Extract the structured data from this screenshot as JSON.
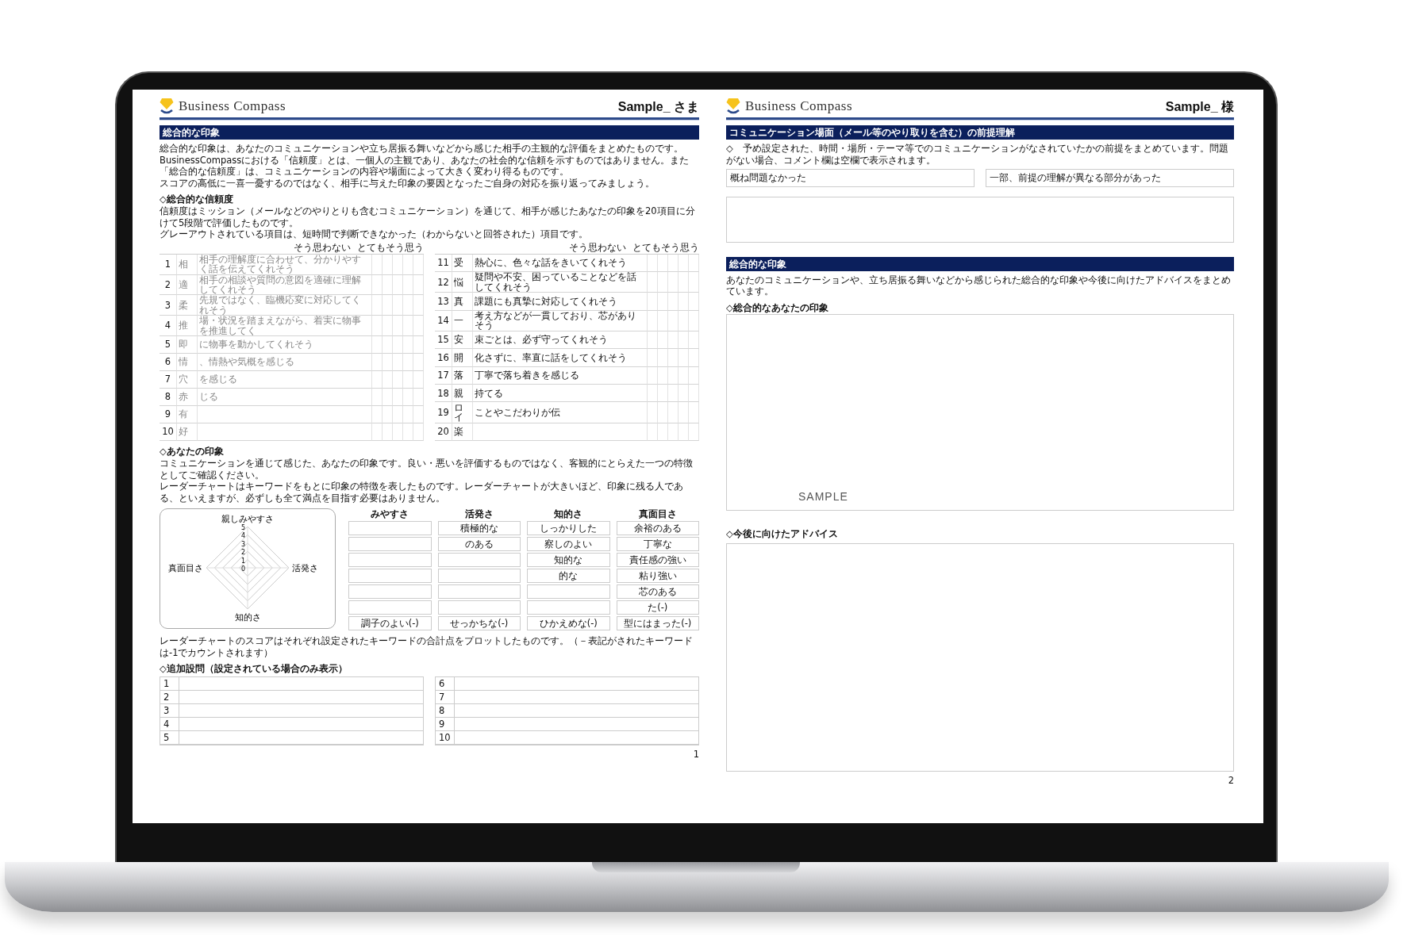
{
  "left_page": {
    "header": {
      "brand": "Business Compass",
      "recipient": "Sample_ さま"
    },
    "section_title": "総合的な印象",
    "intro": [
      "総合的な印象は、あなたのコミュニケーションや立ち居振る舞いなどから感じた相手の主観的な評価をまとめたものです。BusinessCompassにおける「信頼度」とは、一個人の主観であり、あなたの社会的な信頼を示すものではありません。また「総合的な信頼度」は、コミュニケーションの内容や場面によって大きく変わり得るものです。",
      "スコアの高低に一喜一憂するのではなく、相手に与えた印象の要因となったご自身の対応を振り返ってみましょう。"
    ],
    "trust": {
      "heading": "◇総合的な信頼度",
      "description": [
        "信頼度はミッション（メールなどのやりとりも含むコミュニケーション）を通じて、相手が感じたあなたの印象を20項目に分けて5段階で評価したものです。",
        "グレーアウトされている項目は、短時間で判断できなかった（わからないと回答された）項目です。"
      ],
      "columns": [
        {
          "scale_low": "そう思わない",
          "scale_high": "とてもそう思う",
          "rows": [
            {
              "number": "1",
              "label": "相",
              "statement": "相手の理解度に合わせて、分かりやすく話を伝えてくれそう",
              "grayed_out": true
            },
            {
              "number": "2",
              "label": "適",
              "statement": "相手の相談や質問の意図を適確に理解してくれそう",
              "grayed_out": true
            },
            {
              "number": "3",
              "label": "柔",
              "statement": "先規ではなく、臨機応変に対応してくれそう",
              "grayed_out": true
            },
            {
              "number": "4",
              "label": "推",
              "statement": "場・状況を踏まえながら、着実に物事を推進してく",
              "grayed_out": true
            },
            {
              "number": "5",
              "label": "即",
              "statement": "に物事を動かしてくれそう",
              "grayed_out": true
            },
            {
              "number": "6",
              "label": "情",
              "statement": "、情熱や気概を感じる",
              "grayed_out": true
            },
            {
              "number": "7",
              "label": "穴",
              "statement": "を感じる",
              "grayed_out": true
            },
            {
              "number": "8",
              "label": "赤",
              "statement": "じる",
              "grayed_out": true
            },
            {
              "number": "9",
              "label": "有",
              "grayed_out": true
            },
            {
              "number": "10",
              "label": "好",
              "grayed_out": true
            }
          ]
        },
        {
          "scale_low": "そう思わない",
          "scale_high": "とてもそう思う",
          "rows": [
            {
              "number": "11",
              "label": "受",
              "statement": "熱心に、色々な話をきいてくれそう",
              "grayed_out": false
            },
            {
              "number": "12",
              "label": "悩",
              "statement": "疑問や不安、困っていることなどを話してくれそう",
              "grayed_out": false
            },
            {
              "number": "13",
              "label": "真",
              "statement": "課題にも真摯に対応してくれそう",
              "grayed_out": false
            },
            {
              "number": "14",
              "label": "一",
              "statement": "考え方などが一貫しており、芯がありそう",
              "grayed_out": false
            },
            {
              "number": "15",
              "label": "安",
              "statement": "束ごとは、必ず守ってくれそう",
              "grayed_out": false
            },
            {
              "number": "16",
              "label": "開",
              "statement": "化さずに、率直に話をしてくれそう",
              "grayed_out": false
            },
            {
              "number": "17",
              "label": "落",
              "statement": "丁寧で落ち着きを感じる",
              "grayed_out": false
            },
            {
              "number": "18",
              "label": "親",
              "statement": "持てる",
              "grayed_out": false
            },
            {
              "number": "19",
              "label": "ロイ",
              "statement": "ことやこだわりが伝",
              "grayed_out": false
            },
            {
              "number": "20",
              "label": "楽",
              "grayed_out": false
            }
          ]
        }
      ]
    },
    "impression": {
      "heading": "◇あなたの印象",
      "description": [
        "コミュニケーションを通じて感じた、あなたの印象です。良い・悪いを評価するものではなく、客観的にとらえた一つの特徴としてご確認ください。",
        "レーダーチャートはキーワードをもとに印象の特徴を表したものです。レーダーチャートが大きいほど、印象に残る人である、といえますが、必ずしも全て満点を目指す必要はありません。"
      ],
      "radar": {
        "axes": [
          "親しみやすさ",
          "活発さ",
          "知的さ",
          "真面目さ"
        ],
        "ticks": [
          "5",
          "4",
          "3",
          "2",
          "1",
          "0"
        ]
      },
      "keywords": [
        {
          "heading": "みやすさ",
          "cells": [
            null,
            null,
            null,
            null,
            null,
            null,
            "調子のよい(-)"
          ]
        },
        {
          "heading": "活発さ",
          "cells": [
            "積極的な",
            "のある",
            null,
            null,
            null,
            null,
            "せっかちな(-)"
          ]
        },
        {
          "heading": "知的さ",
          "cells": [
            "しっかりした",
            "察しのよい",
            "知的な",
            "的な",
            null,
            null,
            "ひかえめな(-)"
          ]
        },
        {
          "heading": "真面目さ",
          "cells": [
            "余裕のある",
            "丁寧な",
            "責任感の強い",
            "粘り強い",
            "芯のある",
            "た(-)",
            "型にはまった(-)"
          ]
        }
      ],
      "note": "レーダーチャートのスコアはそれぞれ設定されたキーワードの合計点をプロットしたものです。（－表記がされたキーワードは-1でカウントされます）"
    },
    "extra_questions": {
      "heading": "◇追加設問（設定されている場合のみ表示）",
      "columns": [
        [
          "1",
          "2",
          "3",
          "4",
          "5"
        ],
        [
          "6",
          "7",
          "8",
          "9",
          "10"
        ]
      ]
    },
    "page_number": "1"
  },
  "right_page": {
    "header": {
      "brand": "Business Compass",
      "recipient": "Sample_ 様"
    },
    "premise": {
      "title": "コミュニケーション場面（メール等のやり取りを含む）の前提理解",
      "note": "◇　予め設定された、時間・場所・テーマ等でのコミュニケーションがなされていたかの前提をまとめています。問題がない場合、コメント欄は空欄で表示されます。",
      "answers": [
        "概ね問題なかった",
        "一部、前提の理解が異なる部分があった"
      ]
    },
    "overall": {
      "title": "総合的な印象",
      "description": "あなたのコミュニケーションや、立ち居振る舞いなどから感じられた総合的な印象や今後に向けたアドバイスをまとめています。",
      "impression_heading": "◇総合的なあなたの印象",
      "impression_text": "SAMPLE",
      "advice_heading": "◇今後に向けたアドバイス"
    },
    "page_number": "2"
  }
}
